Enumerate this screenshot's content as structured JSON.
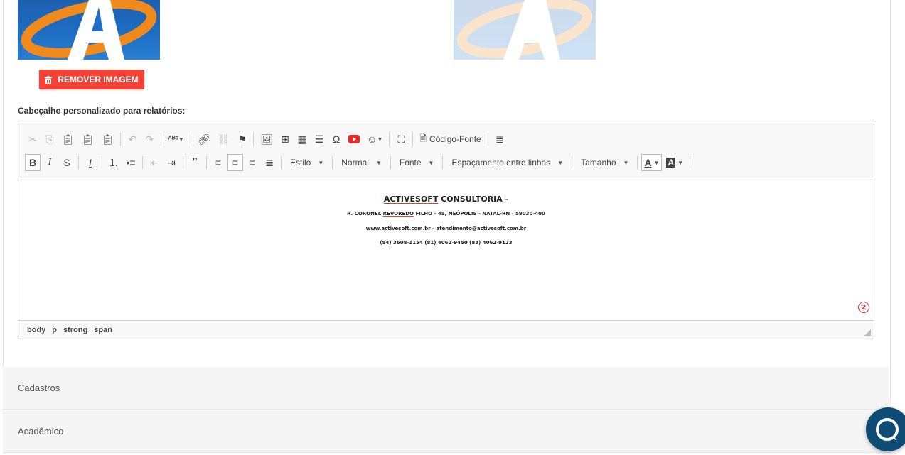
{
  "remove_button": {
    "label": "REMOVER IMAGEM",
    "icon": "trash-icon"
  },
  "header_label": "Cabeçalho personalizado para relatórios:",
  "toolbar": {
    "source_label": "Código-Fonte",
    "style_label": "Estilo",
    "format_label": "Normal",
    "font_label": "Fonte",
    "line_spacing_label": "Espaçamento entre linhas",
    "size_label": "Tamanho",
    "bold": "B",
    "italic": "I",
    "strike": "S",
    "remove_format": "I",
    "text_color": "A",
    "bg_color": "A"
  },
  "content": {
    "line1_word1": "ACTIVESOFT",
    "line1_rest": " CONSULTORIA -",
    "line2_pre": "R. CORONEL ",
    "line2_word": "REVOREDO",
    "line2_post": " FILHO - 45, NEÓPOLIS - NATAL-RN - 59030-400",
    "line3": "www.activesoft.com.br - atendimento@activesoft.com.br",
    "line4": "(84) 3608-1154 (81) 4062-9450 (83) 4062-9123"
  },
  "badge_count": "2",
  "statusbar": [
    "body",
    "p",
    "strong",
    "span"
  ],
  "sections": [
    "Cadastros",
    "Acadêmico"
  ],
  "colors": {
    "accent_red": "#f44336",
    "chat": "#0f4c75"
  }
}
